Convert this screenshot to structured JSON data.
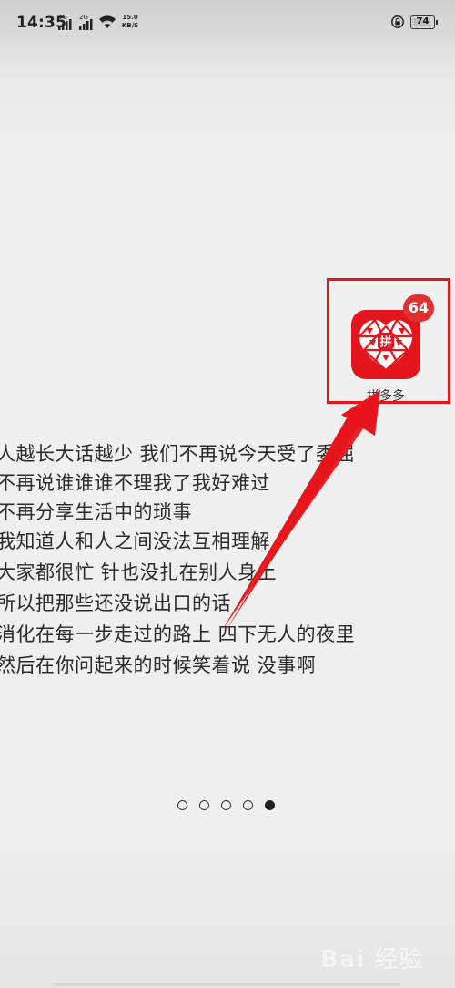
{
  "status_bar": {
    "time": "14:35",
    "signal1_label": "4G",
    "signal2_label": "2G",
    "net_speed_value": "15.0",
    "net_speed_unit": "KB/S",
    "battery_level": "74",
    "icons": [
      "signal-icon",
      "wifi-icon",
      "rotation-lock-icon",
      "battery-icon"
    ]
  },
  "app": {
    "name": "拼多多",
    "badge_count": "64",
    "icon_color": "#e4151c",
    "badge_color": "#e03030"
  },
  "highlight": {
    "color": "#e8141b"
  },
  "lyrics": [
    "人越长大话越少 我们不再说今天受了委屈",
    "不再说谁谁谁不理我了我好难过",
    "不再分享生活中的琐事",
    "我知道人和人之间没法互相理解",
    "大家都很忙 针也没扎在别人身上",
    "所以把那些还没说出口的话",
    "消化在每一步走过的路上 四下无人的夜里",
    "然后在你问起来的时候笑着说 没事啊"
  ],
  "page_indicator": {
    "total": 5,
    "current": 5
  },
  "watermark": {
    "text": "Bai 经验"
  }
}
